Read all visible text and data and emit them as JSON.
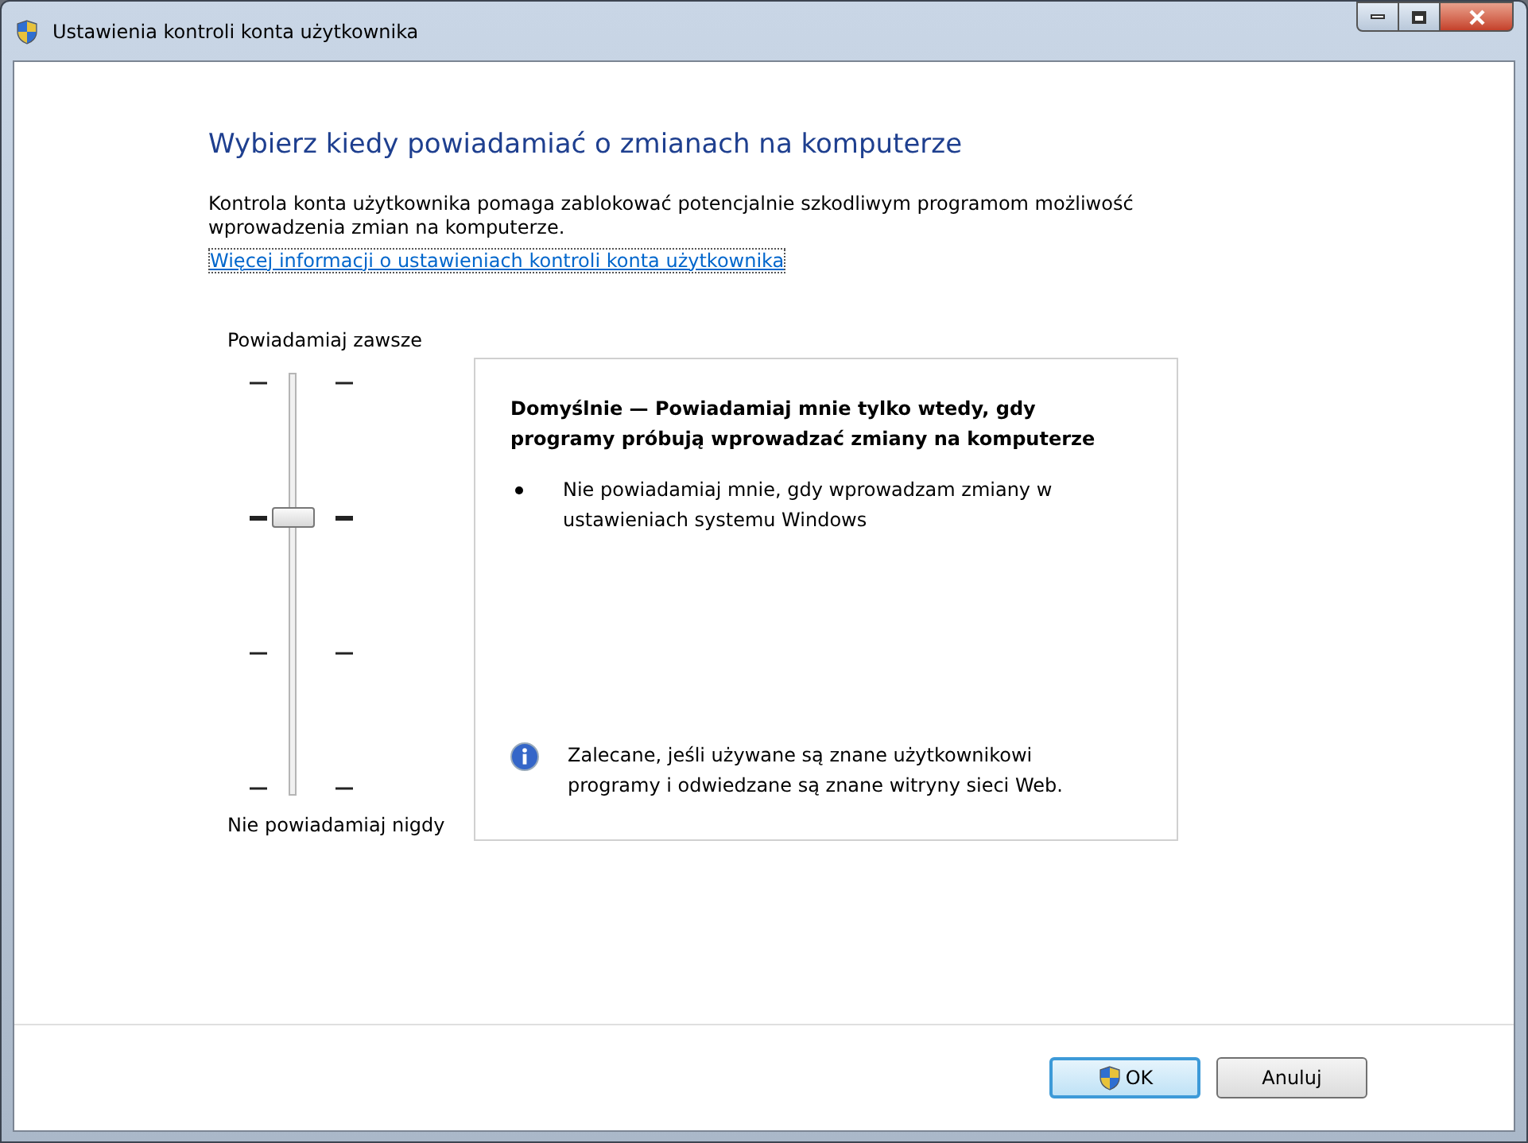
{
  "window": {
    "title": "Ustawienia kontroli konta użytkownika"
  },
  "heading": "Wybierz kiedy powiadamiać o zmianach na komputerze",
  "description": "Kontrola konta użytkownika pomaga zablokować potencjalnie szkodliwym programom możliwość wprowadzenia zmian na komputerze.",
  "link": "Więcej informacji o ustawieniach kontroli konta użytkownika",
  "slider": {
    "top_label": "Powiadamiaj zawsze",
    "bottom_label": "Nie powiadamiaj nigdy",
    "level": 0.667
  },
  "info_box": {
    "title": "Domyślnie — Powiadamiaj mnie tylko wtedy, gdy programy próbują wprowadzać zmiany na komputerze",
    "bullets": [
      "Nie powiadamiaj mnie, gdy wprowadzam zmiany w ustawieniach systemu Windows"
    ],
    "note": "Zalecane, jeśli używane są znane użytkownikowi programy i odwiedzane są znane witryny sieci Web."
  },
  "buttons": [
    {
      "label": "OK",
      "default": true,
      "shield": true
    },
    {
      "label": "Anuluj",
      "default": false,
      "shield": false
    }
  ]
}
